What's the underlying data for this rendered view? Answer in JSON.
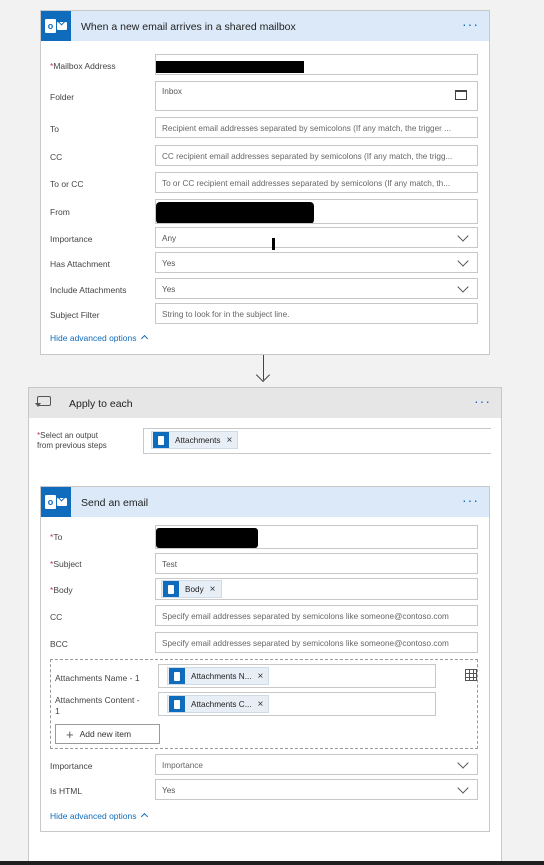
{
  "trigger": {
    "title": "When a new email arrives in a shared mailbox",
    "fields": {
      "mailbox_label": "Mailbox Address",
      "folder_label": "Folder",
      "folder_value": "Inbox",
      "to_label": "To",
      "to_placeholder": "Recipient email addresses separated by semicolons (If any match, the trigger ...",
      "cc_label": "CC",
      "cc_placeholder": "CC recipient email addresses separated by semicolons (If any match, the trigg...",
      "toorcc_label": "To or CC",
      "toorcc_placeholder": "To or CC recipient email addresses separated by semicolons (If any match, th...",
      "from_label": "From",
      "importance_label": "Importance",
      "importance_value": "Any",
      "hasattach_label": "Has Attachment",
      "hasattach_value": "Yes",
      "includeattach_label": "Include Attachments",
      "includeattach_value": "Yes",
      "subject_label": "Subject Filter",
      "subject_placeholder": "String to look for in the subject line."
    },
    "hide_advanced": "Hide advanced options"
  },
  "apply_each": {
    "title": "Apply to each",
    "select_label_1": "Select an output",
    "select_label_2": "from previous steps",
    "token": "Attachments"
  },
  "send_email": {
    "title": "Send an email",
    "to_label": "To",
    "subject_label": "Subject",
    "subject_value": "Test",
    "body_label": "Body",
    "body_token": "Body",
    "cc_label": "CC",
    "cc_placeholder": "Specify email addresses separated by semicolons like someone@contoso.com",
    "bcc_label": "BCC",
    "bcc_placeholder": "Specify email addresses separated by semicolons like someone@contoso.com",
    "attach_name_label": "Attachments Name - 1",
    "attach_name_token": "Attachments N...",
    "attach_content_label_1": "Attachments Content -",
    "attach_content_label_2": "1",
    "attach_content_token": "Attachments C...",
    "add_item": "Add new item",
    "importance_label": "Importance",
    "importance_placeholder": "Importance",
    "ishtml_label": "Is HTML",
    "ishtml_value": "Yes",
    "hide_advanced": "Hide advanced options"
  },
  "glyphs": {
    "more": "···",
    "close": "×",
    "plus": "+",
    "required": "*"
  },
  "colors": {
    "accent": "#0f6cbd",
    "header_blue": "#dbe9f8",
    "required": "#c4314b"
  }
}
